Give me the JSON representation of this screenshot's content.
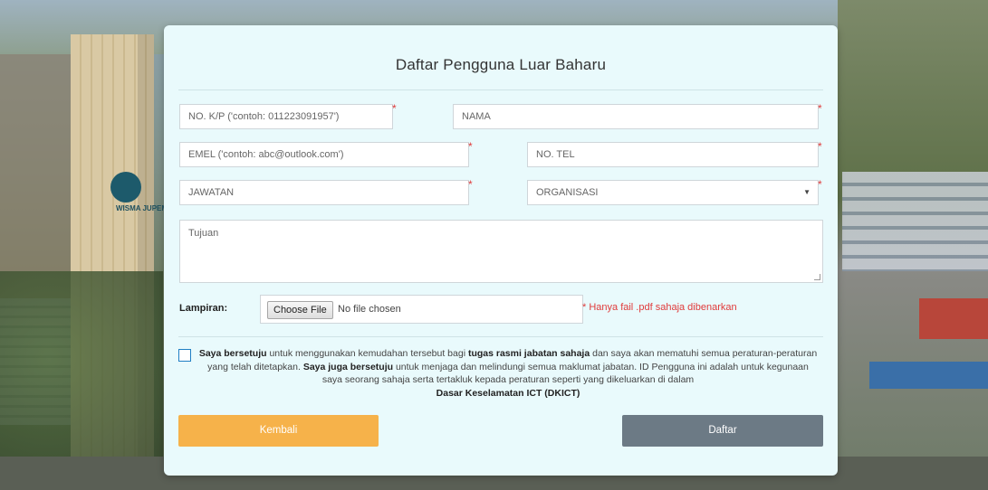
{
  "form": {
    "title": "Daftar Pengguna Luar Baharu",
    "required_mark": "*",
    "fields": {
      "ic_placeholder": "NO. K/P ('contoh: 011223091957')",
      "name_placeholder": "NAMA",
      "email_placeholder": "EMEL ('contoh: abc@outlook.com')",
      "phone_placeholder": "NO. TEL",
      "position_placeholder": "JAWATAN",
      "organization_selected": "ORGANISASI",
      "purpose_placeholder": "Tujuan"
    },
    "attachment": {
      "label": "Lampiran:",
      "button_label": "Choose File",
      "status": "No file chosen",
      "note": "* Hanya fail .pdf sahaja dibenarkan"
    },
    "agreement": {
      "p1_bold": "Saya bersetuju",
      "p2": " untuk menggunakan kemudahan tersebut bagi ",
      "p3_bold": "tugas rasmi jabatan sahaja",
      "p4": " dan saya akan mematuhi semua peraturan-peraturan yang telah ditetapkan. ",
      "p5_bold": "Saya juga bersetuju",
      "p6": " untuk menjaga dan melindungi semua maklumat jabatan. ID Pengguna ini adalah untuk kegunaan saya seorang sahaja serta tertakluk kepada peraturan seperti yang dikeluarkan di dalam ",
      "p7_bold": "Dasar Keselamatan ICT (DKICT)",
      "checked": false
    },
    "buttons": {
      "back_label": "Kembali",
      "submit_label": "Daftar"
    }
  },
  "background": {
    "building_sign": "WISMA JUPEM"
  },
  "colors": {
    "card_bg": "#e9fafc",
    "required": "#e03a3a",
    "back_button": "#f6b24a",
    "submit_button": "#6c7a85",
    "checkbox_border": "#1f7fc4"
  }
}
